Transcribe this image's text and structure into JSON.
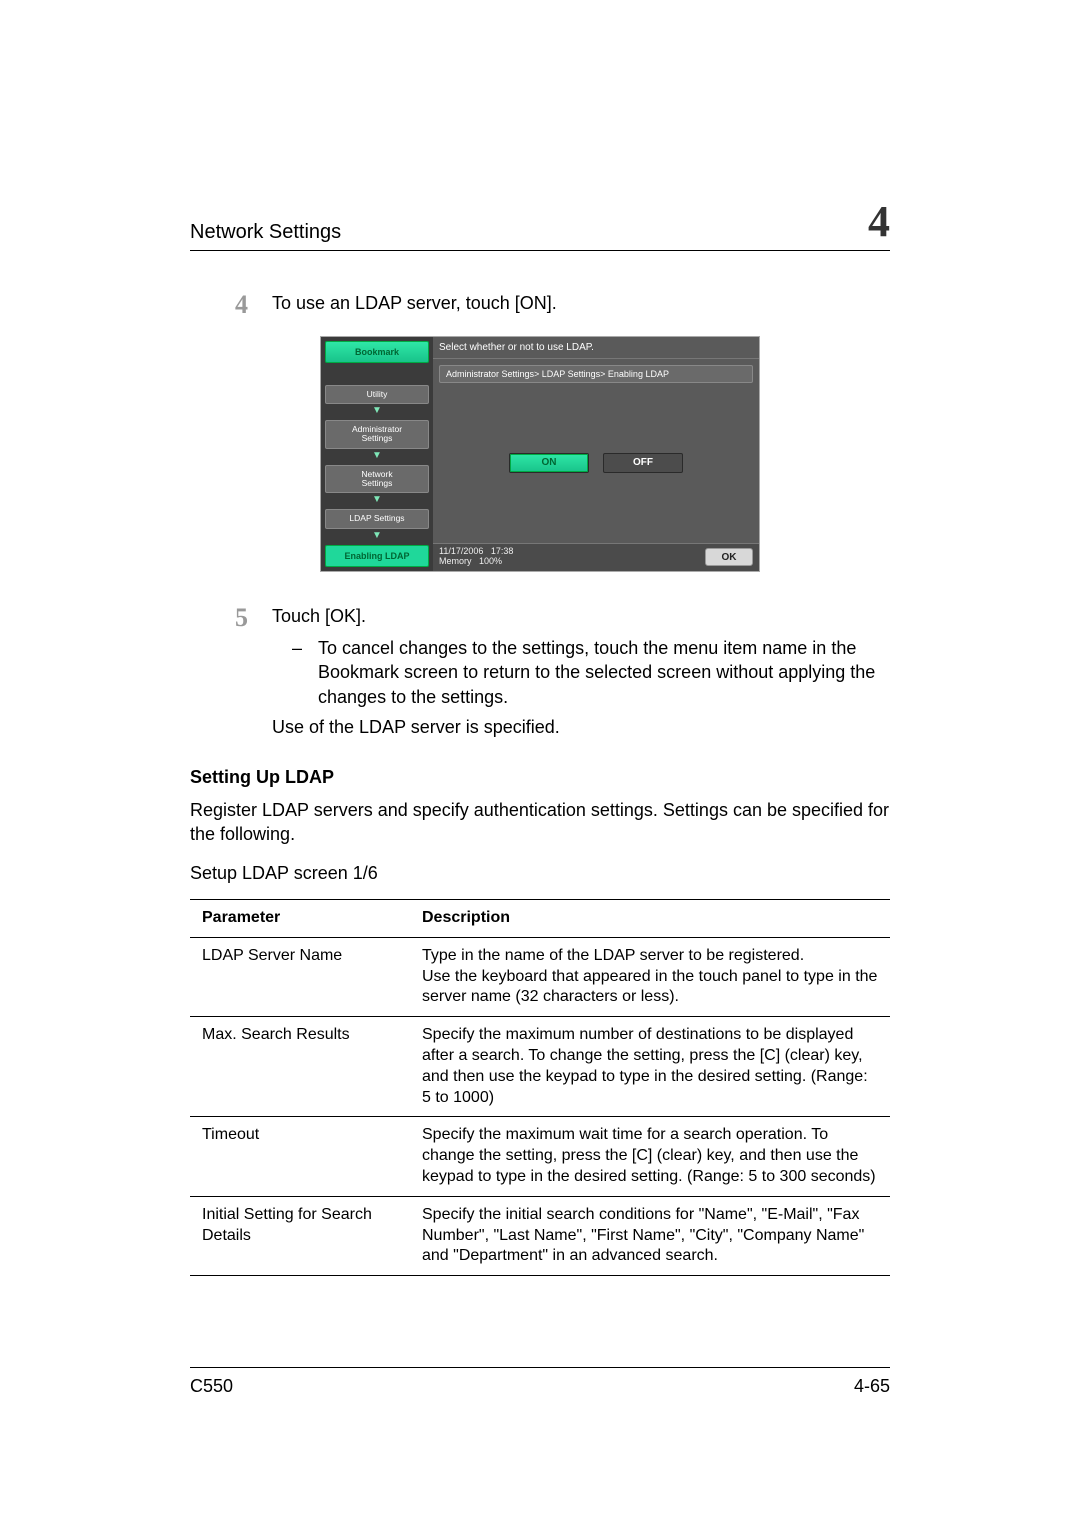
{
  "header": {
    "running_title": "Network Settings",
    "chapter_number": "4"
  },
  "steps": [
    {
      "num": "4",
      "text": "To use an LDAP server, touch [ON]."
    },
    {
      "num": "5",
      "text": "Touch [OK].",
      "sub": "To cancel changes to the settings, touch the menu item name in the Bookmark screen to return to the selected screen without applying the changes to the settings.",
      "after": "Use of the LDAP server is specified."
    }
  ],
  "mfp": {
    "title_bar": "Select whether or not to use LDAP.",
    "breadcrumb": "Administrator Settings> LDAP Settings> Enabling LDAP",
    "bookmark": "Bookmark",
    "side_items": [
      "Utility",
      "Administrator\nSettings",
      "Network\nSettings",
      "LDAP Settings"
    ],
    "enabling": "Enabling LDAP",
    "on": "ON",
    "off": "OFF",
    "ok": "OK",
    "date": "11/17/2006",
    "time": "17:38",
    "memory": "Memory",
    "memory_pct": "100%"
  },
  "section": {
    "heading": "Setting Up LDAP",
    "intro": "Register LDAP servers and specify authentication settings. Settings can be specified for the following.",
    "screen_label": "Setup LDAP screen 1/6",
    "columns": {
      "param": "Parameter",
      "desc": "Description"
    },
    "rows": [
      {
        "param": "LDAP Server Name",
        "desc": "Type in the name of the LDAP server to be registered.\nUse the keyboard that appeared in the touch panel to type in the server name (32 characters or less)."
      },
      {
        "param": "Max. Search Results",
        "desc": "Specify the maximum number of destinations to be displayed after a search. To change the setting, press the [C] (clear) key, and then use the keypad to type in the desired setting. (Range: 5 to 1000)"
      },
      {
        "param": "Timeout",
        "desc": "Specify the maximum wait time for a search operation. To change the setting, press the [C] (clear) key, and then use the keypad to type in the desired setting. (Range: 5 to 300 seconds)"
      },
      {
        "param": "Initial Setting for Search Details",
        "desc": "Specify the initial search conditions for \"Name\", \"E-Mail\", \"Fax Number\", \"Last Name\", \"First Name\", \"City\", \"Company Name\" and \"Department\" in an advanced search."
      }
    ]
  },
  "footer": {
    "model": "C550",
    "page": "4-65"
  }
}
